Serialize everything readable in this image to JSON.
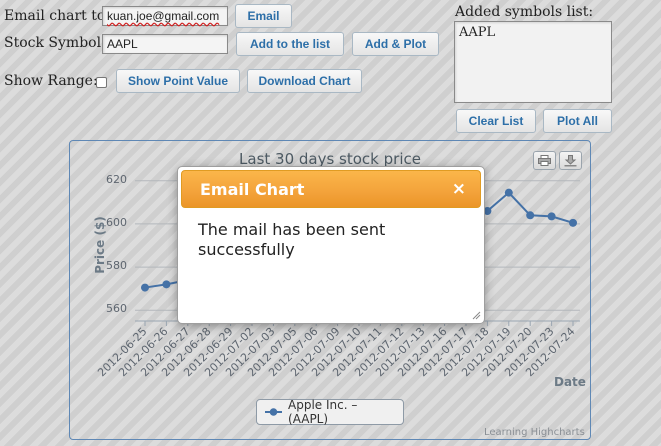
{
  "form": {
    "email_label": "Email chart to:",
    "email_value": "kuan.joe@gmail.com",
    "email_button": "Email",
    "symbol_label": "Stock Symbol:",
    "symbol_value": "AAPL",
    "add_list_button": "Add to the list",
    "add_plot_button": "Add & Plot",
    "range_label": "Show Range:",
    "show_point_button": "Show Point Value",
    "download_button": "Download Chart"
  },
  "symbols_panel": {
    "label": "Added symbols list:",
    "items": [
      "AAPL"
    ],
    "clear_button": "Clear List",
    "plot_all_button": "Plot All"
  },
  "chart_data": {
    "type": "line",
    "title": "Last 30 days stock price",
    "ylabel": "Price ($)",
    "xlabel": "Date",
    "ylim": [
      555,
      625
    ],
    "yticks": [
      560,
      580,
      600,
      620
    ],
    "categories": [
      "2012-06-25",
      "2012-06-26",
      "2012-06-27",
      "2012-06-28",
      "2012-06-29",
      "2012-07-02",
      "2012-07-03",
      "2012-07-05",
      "2012-07-06",
      "2012-07-09",
      "2012-07-10",
      "2012-07-11",
      "2012-07-12",
      "2012-07-13",
      "2012-07-16",
      "2012-07-17",
      "2012-07-18",
      "2012-07-19",
      "2012-07-20",
      "2012-07-23",
      "2012-07-24"
    ],
    "series": [
      {
        "name": "Apple Inc. – (AAPL)",
        "color": "#4572a7",
        "values": [
          570.5,
          572,
          574,
          569.5,
          584,
          592.5,
          599.5,
          609.5,
          605.5,
          613.5,
          604.5,
          604,
          598.5,
          604.5,
          606.5,
          606.9,
          606,
          614.5,
          604,
          603.5,
          600.5
        ]
      }
    ],
    "grid": true,
    "legend_position": "bottom-center",
    "credits": "Learning Highcharts"
  },
  "dialog": {
    "title": "Email Chart",
    "close_glyph": "×",
    "message": "The mail has been sent successfully"
  },
  "icons": {
    "print": "print-icon",
    "export": "download-icon"
  }
}
